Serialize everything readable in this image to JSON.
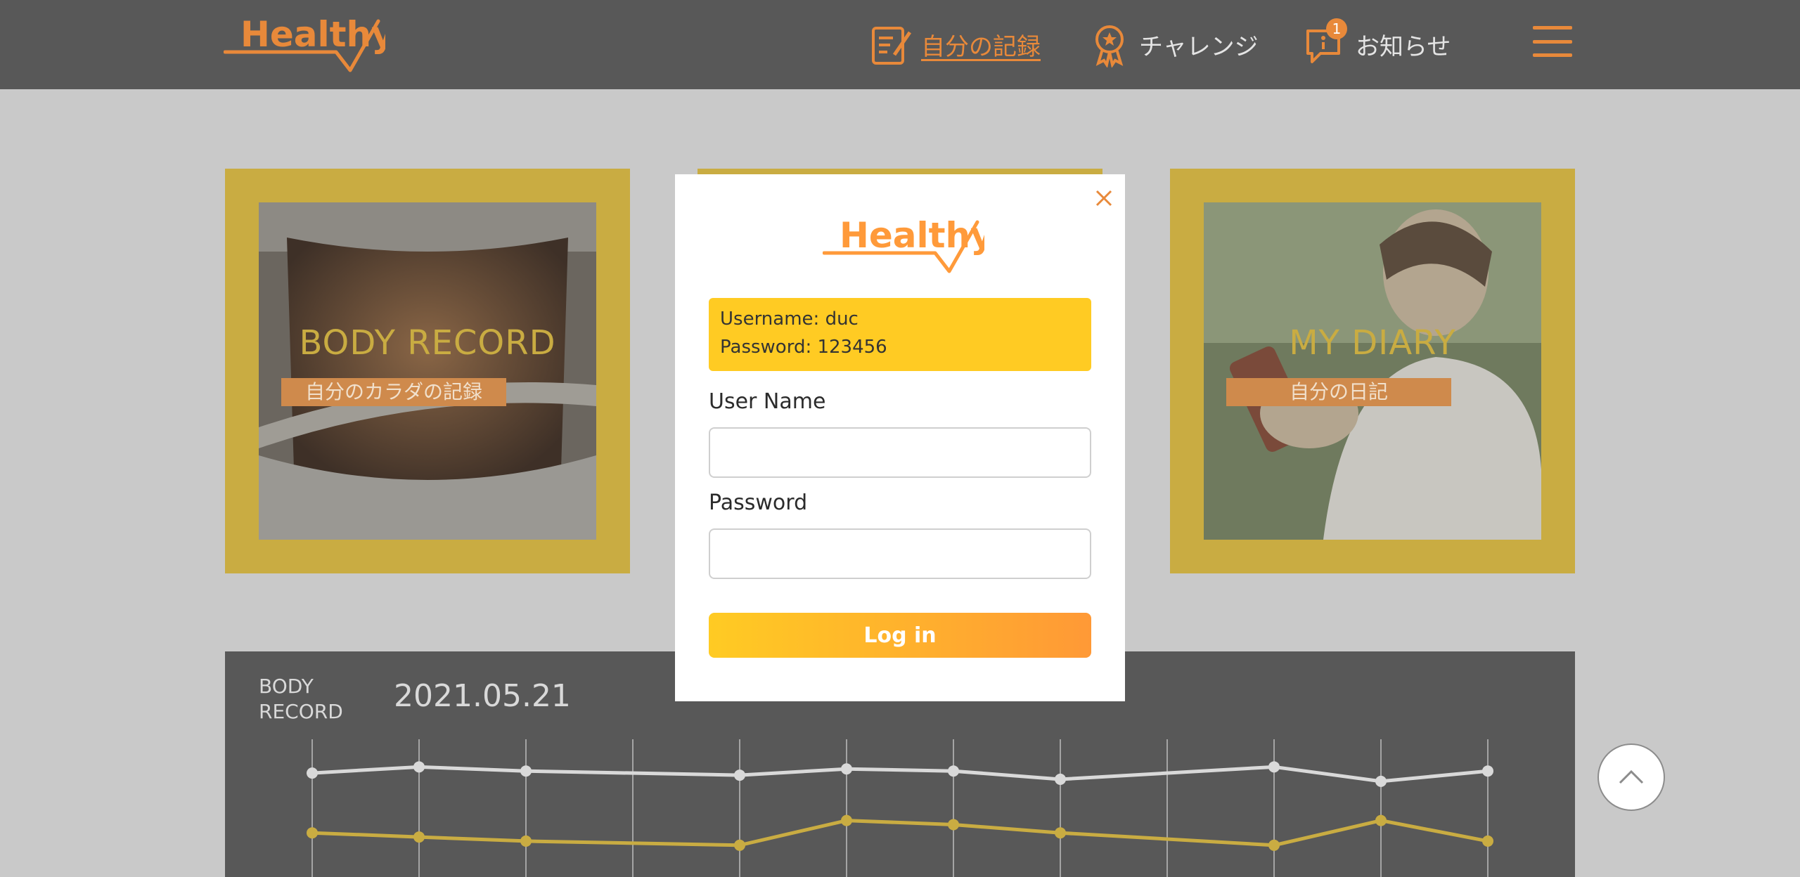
{
  "header": {
    "logo_text": "Healthy",
    "nav": [
      {
        "label": "自分の記録",
        "icon": "memo-icon",
        "active": true
      },
      {
        "label": "チャレンジ",
        "icon": "medal-icon",
        "active": false
      },
      {
        "label": "お知らせ",
        "icon": "info-icon",
        "active": false,
        "badge": "1"
      }
    ],
    "menu_icon": "hamburger-icon"
  },
  "cards": [
    {
      "title": "BODY RECORD",
      "subtitle": "自分のカラダの記録"
    },
    {
      "title": "MY DIARY",
      "subtitle": "自分の日記"
    }
  ],
  "body_record": {
    "label_line1": "BODY",
    "label_line2": "RECORD",
    "date": "2021.05.21"
  },
  "chart_data": {
    "type": "line",
    "x": [
      1,
      2,
      3,
      4,
      5,
      6,
      7,
      8,
      9,
      10,
      11,
      12
    ],
    "series": [
      {
        "values": [
          67,
          70,
          68,
          null,
          66,
          69,
          68,
          64,
          null,
          70,
          63,
          68
        ],
        "color": "#d9d9d9"
      },
      {
        "values": [
          38,
          36,
          34,
          null,
          32,
          44,
          42,
          38,
          null,
          32,
          44,
          34
        ],
        "color": "#c9ac42"
      }
    ],
    "grid": true
  },
  "modal": {
    "logo_text": "Healthy",
    "hint_username": "Username: duc",
    "hint_password": "Password: 123456",
    "username_label": "User Name",
    "password_label": "Password",
    "username_value": "",
    "password_value": "",
    "login_label": "Log in"
  },
  "colors": {
    "accent": "#e8893a",
    "gold": "#c9ac42",
    "dark": "#585858",
    "hint_bg": "#ffcb23"
  }
}
